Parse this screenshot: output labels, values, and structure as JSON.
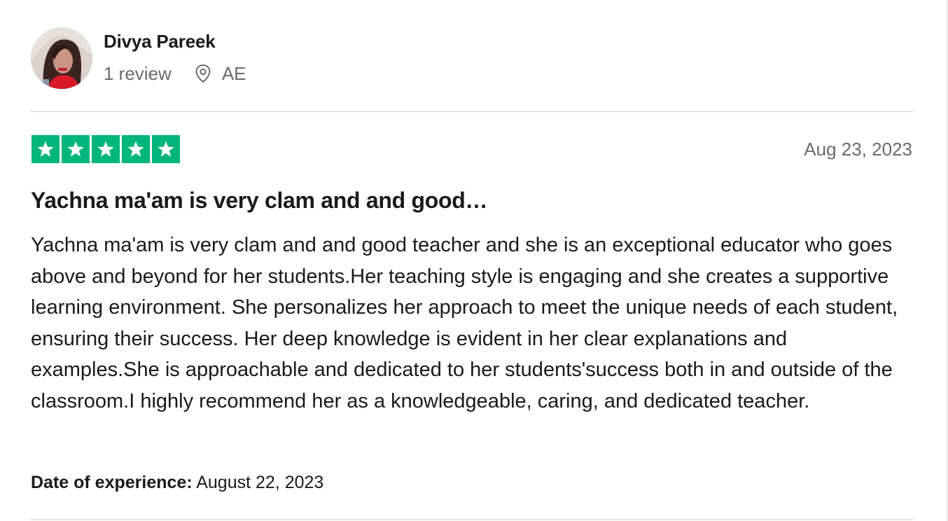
{
  "consumer": {
    "name": "Divya Pareek",
    "review_count": "1 review",
    "location": "AE",
    "avatar_icon": "user-avatar-photo"
  },
  "review": {
    "rating": 5,
    "rating_max": 5,
    "star_color": "#00b67a",
    "star_icon": "star-icon",
    "date": "Aug 23, 2023",
    "title": "Yachna ma'am is very clam and and good…",
    "body": "Yachna ma'am is very clam and and good teacher and she is an exceptional educator who goes above and beyond for her students.Her teaching style is engaging and she creates a supportive learning environment. She personalizes her approach to meet the unique needs of each student, ensuring their success. Her deep knowledge is evident in her clear explanations and examples.She is approachable and dedicated to her students'success both in and outside of the classroom.I highly recommend her as a knowledgeable, caring, and dedicated teacher.",
    "experience_label": "Date of experience:",
    "experience_date": "August 22, 2023"
  }
}
